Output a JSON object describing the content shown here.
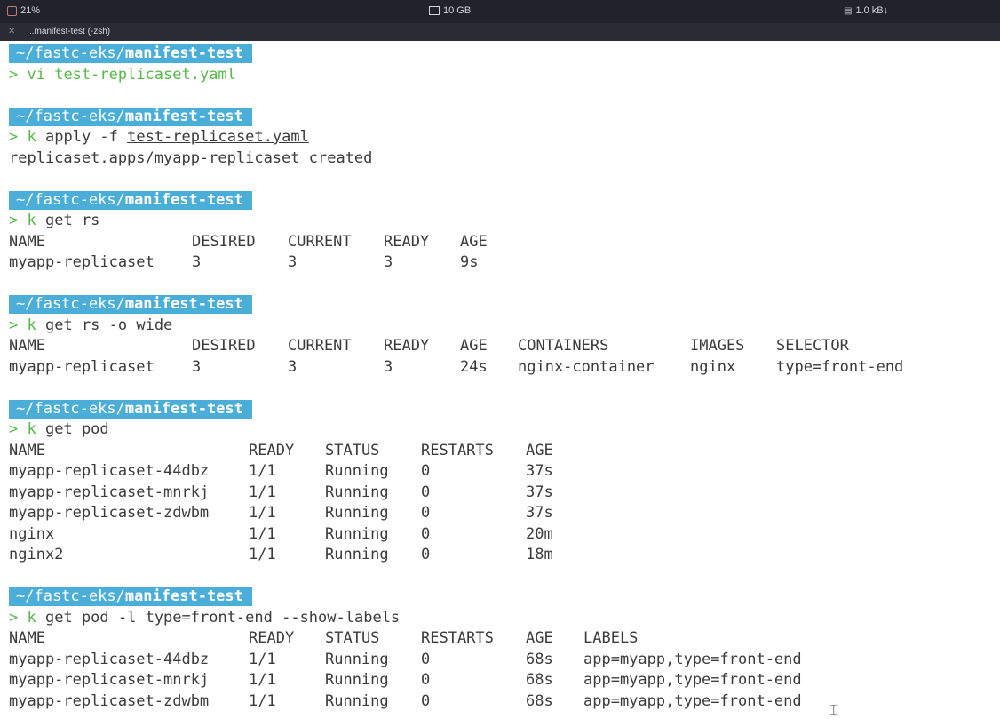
{
  "status_bar": {
    "cpu": "21%",
    "memory": "10 GB",
    "network": "1.0 kB↓"
  },
  "tab": {
    "title": "..manifest-test (-zsh)",
    "close": "✕"
  },
  "prompt": {
    "prefix": "~/fastc-eks/",
    "dir": "manifest-test",
    "char": ">"
  },
  "commands": {
    "c1": "vi test-replicaset.yaml",
    "c2_pre": "apply -f ",
    "c2_file": "test-replicaset.yaml",
    "c3": "get rs",
    "c4": "get rs -o wide",
    "c5": "get pod",
    "c6": "get pod -l type=front-end --show-labels",
    "k": "k"
  },
  "outputs": {
    "created": "replicaset.apps/myapp-replicaset created"
  },
  "rs_table": {
    "headers": [
      "NAME",
      "DESIRED",
      "CURRENT",
      "READY",
      "AGE"
    ],
    "rows": [
      [
        "myapp-replicaset",
        "3",
        "3",
        "3",
        "9s"
      ]
    ]
  },
  "rs_wide_table": {
    "headers": [
      "NAME",
      "DESIRED",
      "CURRENT",
      "READY",
      "AGE",
      "CONTAINERS",
      "IMAGES",
      "SELECTOR"
    ],
    "rows": [
      [
        "myapp-replicaset",
        "3",
        "3",
        "3",
        "24s",
        "nginx-container",
        "nginx",
        "type=front-end"
      ]
    ]
  },
  "pod_table": {
    "headers": [
      "NAME",
      "READY",
      "STATUS",
      "RESTARTS",
      "AGE"
    ],
    "rows": [
      [
        "myapp-replicaset-44dbz",
        "1/1",
        "Running",
        "0",
        "37s"
      ],
      [
        "myapp-replicaset-mnrkj",
        "1/1",
        "Running",
        "0",
        "37s"
      ],
      [
        "myapp-replicaset-zdwbm",
        "1/1",
        "Running",
        "0",
        "37s"
      ],
      [
        "nginx",
        "1/1",
        "Running",
        "0",
        "20m"
      ],
      [
        "nginx2",
        "1/1",
        "Running",
        "0",
        "18m"
      ]
    ]
  },
  "pod_labels_table": {
    "headers": [
      "NAME",
      "READY",
      "STATUS",
      "RESTARTS",
      "AGE",
      "LABELS"
    ],
    "rows": [
      [
        "myapp-replicaset-44dbz",
        "1/1",
        "Running",
        "0",
        "68s",
        "app=myapp,type=front-end"
      ],
      [
        "myapp-replicaset-mnrkj",
        "1/1",
        "Running",
        "0",
        "68s",
        "app=myapp,type=front-end"
      ],
      [
        "myapp-replicaset-zdwbm",
        "1/1",
        "Running",
        "0",
        "68s",
        "app=myapp,type=front-end"
      ]
    ]
  }
}
